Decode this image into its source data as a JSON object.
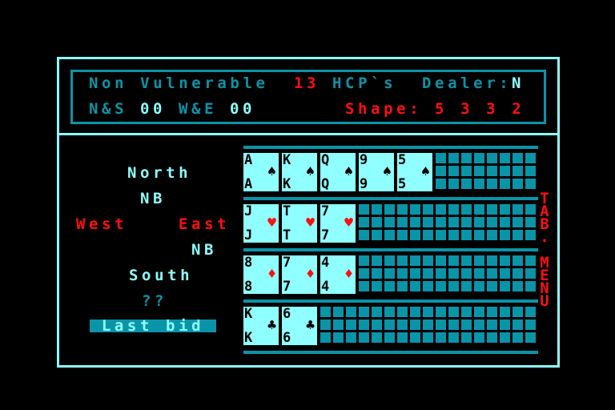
{
  "header": {
    "vulnerability": "Non Vulnerable",
    "hcp": "13",
    "hcp_label": "HCP`s",
    "dealer_label": "Dealer:",
    "dealer": "N",
    "ns_label": "N&S",
    "ns_score": "00",
    "we_label": "W&E",
    "we_score": "00",
    "shape_label": "Shape:",
    "shape": "5 3 3 2"
  },
  "table": {
    "north": "North",
    "north_bid": "NB",
    "west": "West",
    "east": "East",
    "east_bid": "NB",
    "south": "South",
    "south_bid": "??",
    "last_bid_button": "Last bid"
  },
  "side_menu": "TAB. MENU",
  "hand": [
    {
      "suit": "spades",
      "symbol": "♠",
      "color": "#000000",
      "cards": [
        "A",
        "K",
        "Q",
        "9",
        "5"
      ]
    },
    {
      "suit": "hearts",
      "symbol": "♥",
      "color": "#ff1010",
      "cards": [
        "J",
        "T",
        "7"
      ]
    },
    {
      "suit": "diamonds",
      "symbol": "♦",
      "color": "#ff1010",
      "cards": [
        "8",
        "7",
        "4"
      ]
    },
    {
      "suit": "clubs",
      "symbol": "♣",
      "color": "#000000",
      "cards": [
        "K",
        "6"
      ]
    }
  ],
  "colors": {
    "teal": "#0a94a8",
    "cyan": "#90ffff",
    "red": "#ff1010",
    "background": "#000000"
  }
}
